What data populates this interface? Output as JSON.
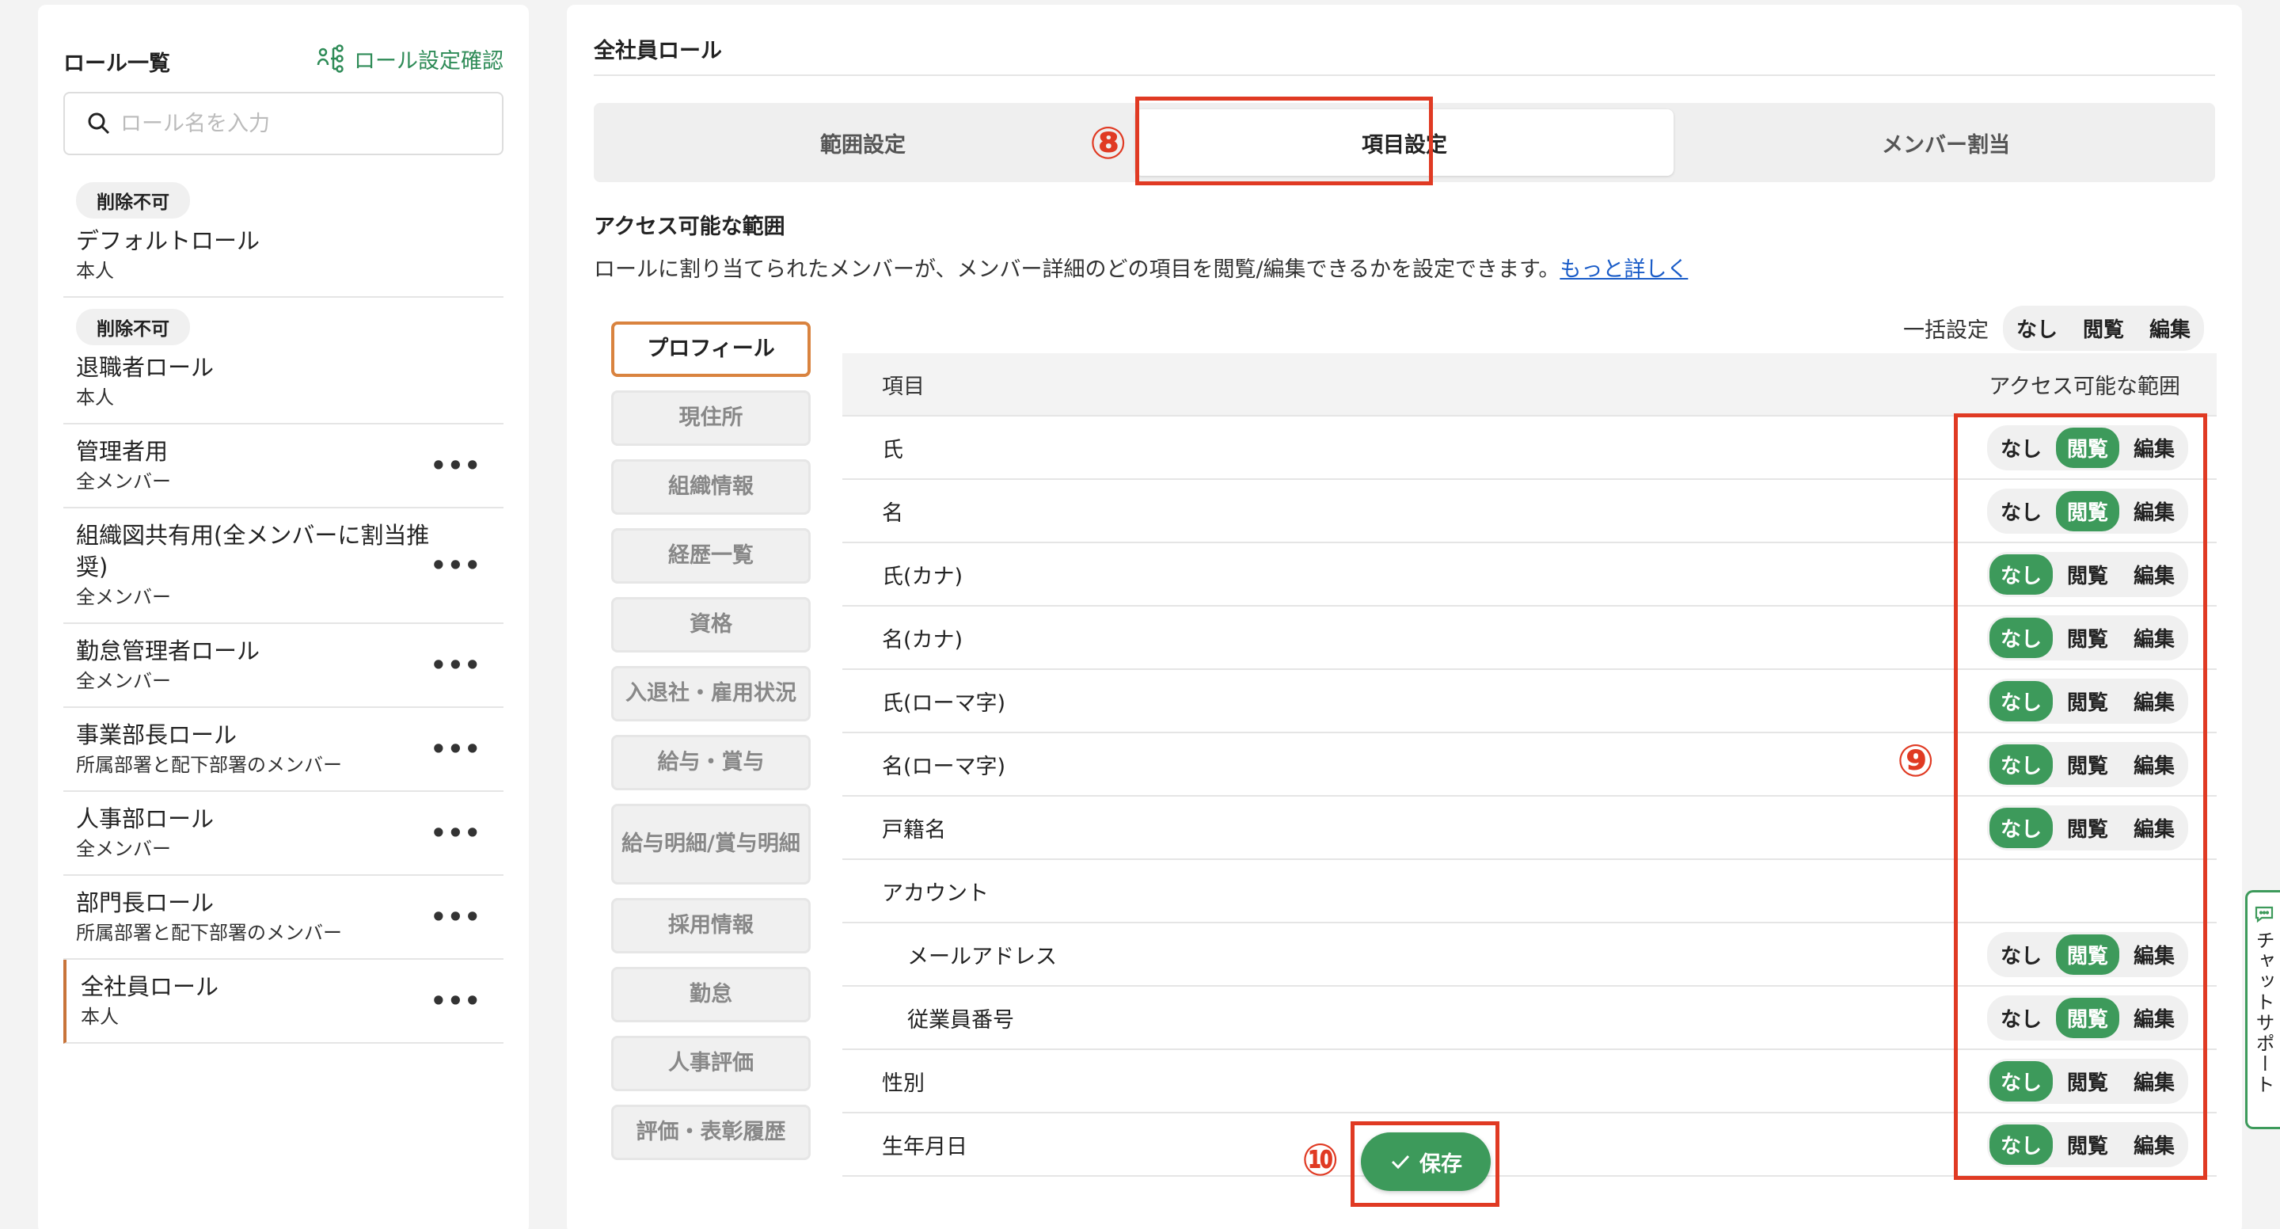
{
  "left": {
    "title": "ロール一覧",
    "role_check_link": "ロール設定確認",
    "search_placeholder": "ロール名を入力",
    "roles": [
      {
        "badge": "削除不可",
        "name": "デフォルトロール",
        "scope": "本人"
      },
      {
        "badge": "削除不可",
        "name": "退職者ロール",
        "scope": "本人"
      },
      {
        "name": "管理者用",
        "scope": "全メンバー",
        "more": "•••"
      },
      {
        "name": "組織図共有用(全メンバーに割当推奨)",
        "scope": "全メンバー",
        "more": "•••"
      },
      {
        "name": "勤怠管理者ロール",
        "scope": "全メンバー",
        "more": "•••"
      },
      {
        "name": "事業部長ロール",
        "scope": "所属部署と配下部署のメンバー",
        "more": "•••"
      },
      {
        "name": "人事部ロール",
        "scope": "全メンバー",
        "more": "•••"
      },
      {
        "name": "部門長ロール",
        "scope": "所属部署と配下部署のメンバー",
        "more": "•••"
      },
      {
        "name": "全社員ロール",
        "scope": "本人",
        "more": "•••"
      }
    ]
  },
  "right": {
    "title": "全社員ロール",
    "tabs": [
      "範囲設定",
      "項目設定",
      "メンバー割当"
    ],
    "section_title": "アクセス可能な範囲",
    "section_desc": "ロールに割り当てられたメンバーが、メンバー詳細のどの項目を閲覧/編集できるかを設定できます。",
    "more_link": "もっと詳しく",
    "categories": [
      "プロフィール",
      "現住所",
      "組織情報",
      "経歴一覧",
      "資格",
      "入退社・雇用状況",
      "給与・賞与",
      "給与明細/賞与明細",
      "採用情報",
      "勤怠",
      "人事評価",
      "評価・表彰履歴"
    ],
    "bulk_label": "一括設定",
    "options": [
      "なし",
      "閲覧",
      "編集"
    ],
    "table_head": {
      "item": "項目",
      "access": "アクセス可能な範囲"
    },
    "rows": [
      {
        "name": "氏",
        "value": "閲覧"
      },
      {
        "name": "名",
        "value": "閲覧"
      },
      {
        "name": "氏(カナ)",
        "value": "なし"
      },
      {
        "name": "名(カナ)",
        "value": "なし"
      },
      {
        "name": "氏(ローマ字)",
        "value": "なし"
      },
      {
        "name": "名(ローマ字)",
        "value": "なし"
      },
      {
        "name": "戸籍名",
        "value": "なし"
      },
      {
        "name": "アカウント",
        "value": ""
      },
      {
        "name": "メールアドレス",
        "value": "閲覧",
        "sub": true
      },
      {
        "name": "従業員番号",
        "value": "閲覧",
        "sub": true
      },
      {
        "name": "性別",
        "value": "なし"
      },
      {
        "name": "生年月日",
        "value": "なし"
      }
    ],
    "save_label": "保存"
  },
  "annotations": [
    "⑧",
    "⑨",
    "⑩"
  ],
  "chat_support": "チャットサポート",
  "colors": {
    "accent_green": "#3d9a5b",
    "annotation_red": "#e03a23",
    "active_orange": "#d9833f",
    "link_blue": "#1a5cc8"
  }
}
